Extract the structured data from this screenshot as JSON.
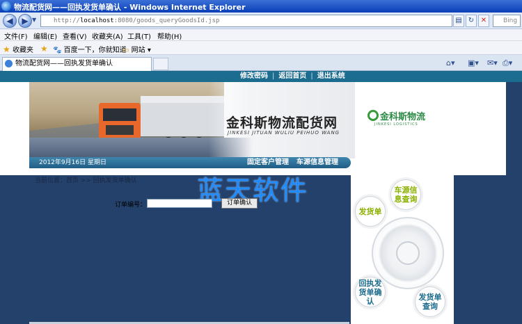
{
  "window": {
    "title": "物流配货网——回执发货单确认 - Windows Internet Explorer"
  },
  "addressbar": {
    "url_prefix": "http://",
    "url_host": "localhost",
    "url_rest": ":8080/goods_queryGoodsId.jsp",
    "search_placeholder": "Bing"
  },
  "menu": [
    "文件(F)",
    "编辑(E)",
    "查看(V)",
    "收藏夹(A)",
    "工具(T)",
    "帮助(H)"
  ],
  "favorites": {
    "label": "收藏夹",
    "items": [
      "百度一下，你就知道",
      "网站"
    ]
  },
  "tab": {
    "title": "物流配货网——回执发货单确认"
  },
  "page": {
    "top_links": [
      "修改密码",
      "返回首页",
      "退出系统"
    ],
    "company_cn": "金科斯物流配货网",
    "company_en": "JINKESI JITUAN WULIU PEIHUO WANG",
    "logo_cn": "金科斯物流",
    "logo_en": "JINKESI LOGISTICS",
    "date": "2012年9月16日 星期日",
    "managers": [
      "固定客户管理",
      "车源信息管理"
    ],
    "breadcrumb": "当前位置：首页 >> 回执发货单确认",
    "watermark": "蓝天软件",
    "order_label": "订单编号：",
    "order_button": "订单确认",
    "wheel": {
      "vehicle": "车源信息查询",
      "ship": "发货单",
      "receipt": "回执发货单确认",
      "query": "发货单查询"
    }
  },
  "colors": {
    "page_bg": "#24416b",
    "topnav": "#1c6c90",
    "watermark": "#1e8bff",
    "logo_green": "#2c8b45"
  }
}
